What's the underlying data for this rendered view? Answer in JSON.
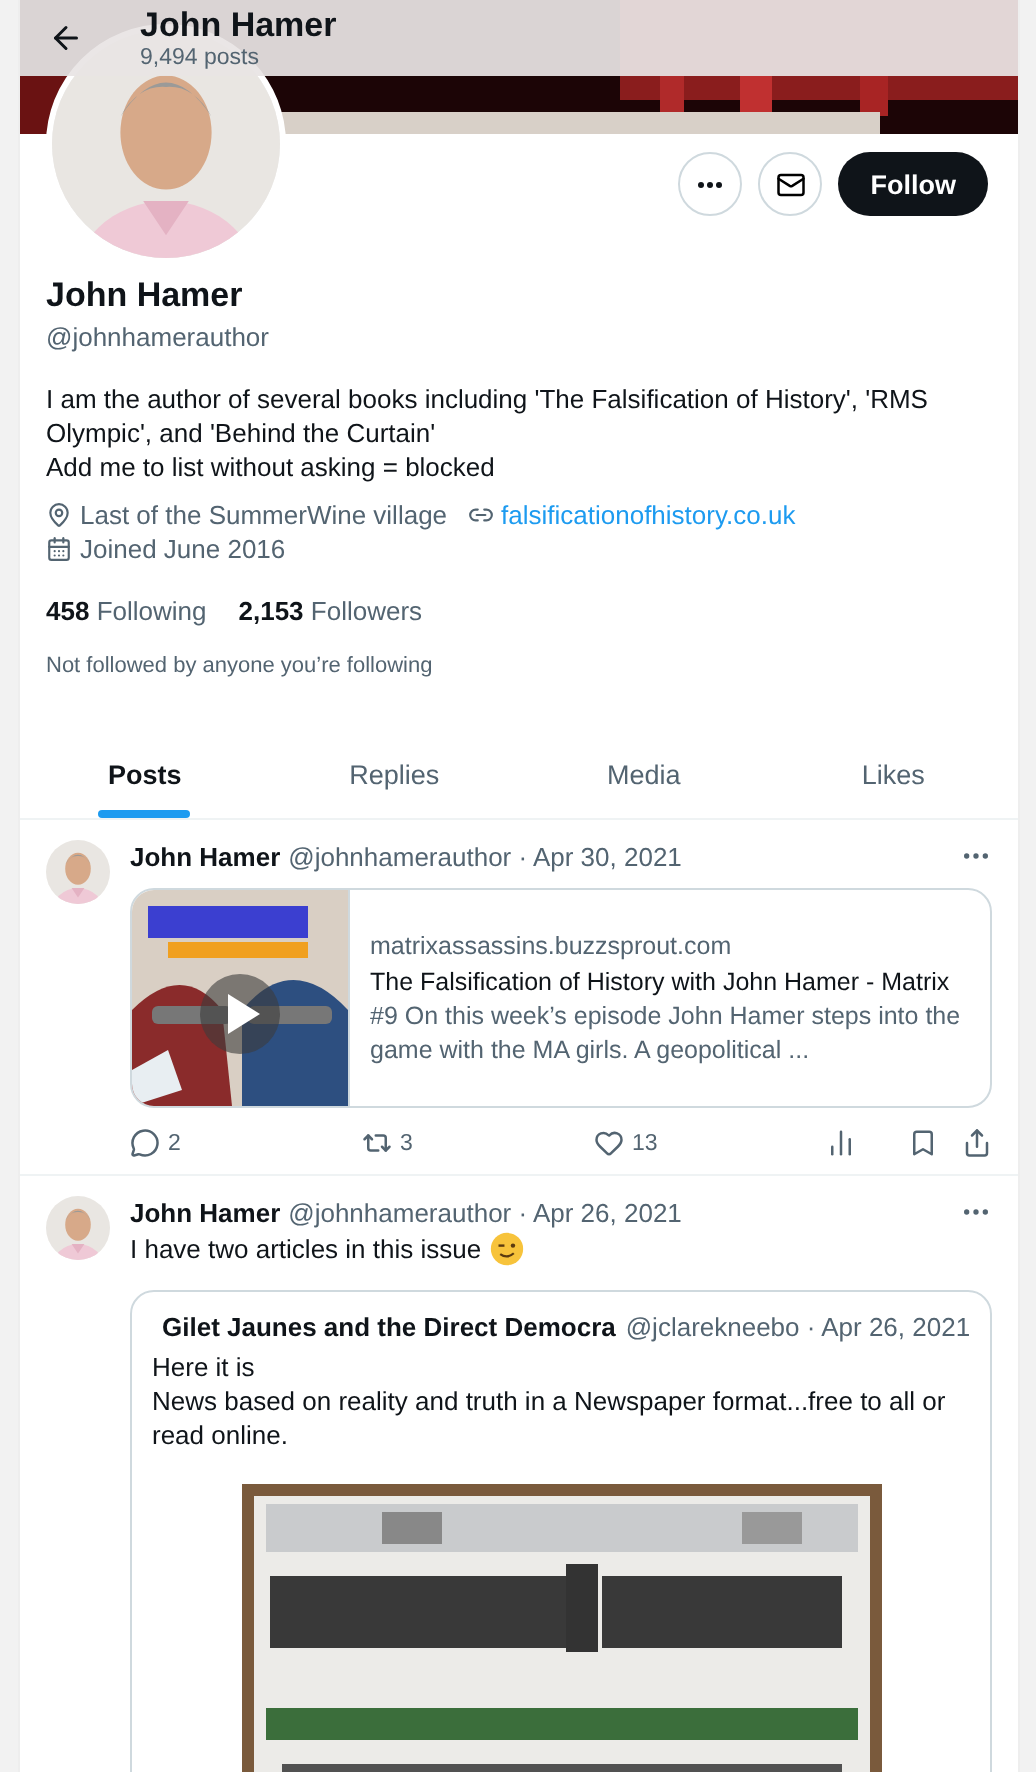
{
  "header": {
    "title": "John Hamer",
    "posts": "9,494 posts"
  },
  "profile": {
    "name": "John Hamer",
    "handle": "@johnhamerauthor",
    "bio": [
      "I am the author of several books including 'The Falsification of History', 'RMS Olympic', and 'Behind the Curtain'",
      "Add me to list without asking = blocked"
    ],
    "location": "Last of the SummerWine village",
    "website": "falsificationofhistory.co.uk",
    "joined": "Joined June 2016",
    "following_count": "458",
    "following_label": "Following",
    "followers_count": "2,153",
    "followers_label": "Followers",
    "followed_by": "Not followed by anyone you’re following",
    "follow_button": "Follow"
  },
  "tabs": [
    {
      "label": "Posts",
      "selected": true
    },
    {
      "label": "Replies",
      "selected": false
    },
    {
      "label": "Media",
      "selected": false
    },
    {
      "label": "Likes",
      "selected": false
    }
  ],
  "posts": [
    {
      "kind": "link",
      "name": "John Hamer",
      "meta": "@johnhamerauthor · Apr 30, 2021",
      "card": {
        "domain": "matrixassassins.buzzsprout.com",
        "title": "The Falsification of History with John Hamer - Matrix",
        "description": "#9 On this week’s episode John Hamer steps into the game with the MA girls.  A geopolitical ..."
      },
      "replies": "2",
      "reposts": "3",
      "likes": "13"
    },
    {
      "kind": "quote",
      "name": "John Hamer",
      "meta": "@johnhamerauthor · Apr 26, 2021",
      "text": "I have two articles in this issue",
      "quote": {
        "name": "Gilet Jaunes and the Direct Democra",
        "meta": "@jclarekneebo · Apr 26, 2021",
        "lines": [
          "Here it is",
          "News based on reality and truth in a Newspaper format...free to all or read online."
        ]
      }
    }
  ]
}
